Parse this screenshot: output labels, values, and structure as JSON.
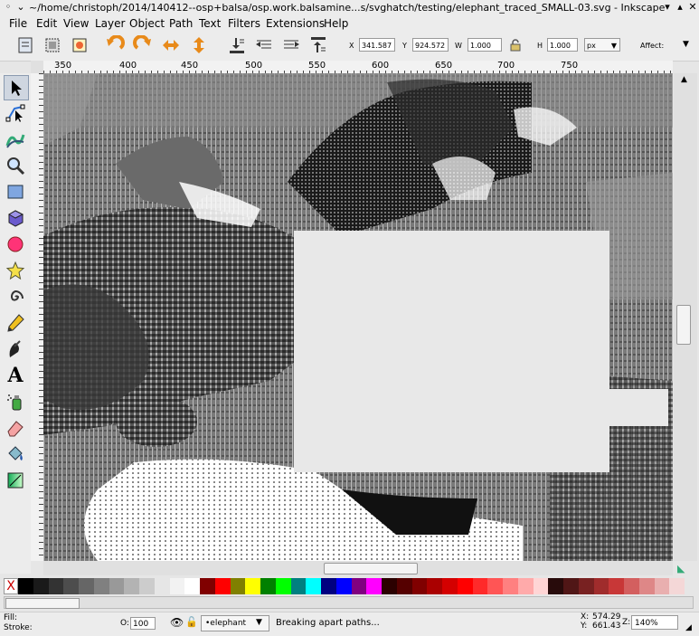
{
  "window": {
    "title": "~/home/christoph/2014/140412--osp+balsa/osp.work.balsamine...s/svghatch/testing/elephant_traced_SMALL-03.svg - Inkscape"
  },
  "menu": [
    "File",
    "Edit",
    "View",
    "Layer",
    "Object",
    "Path",
    "Text",
    "Filters",
    "Extensions",
    "Help"
  ],
  "toolbar": {
    "x_label": "X",
    "x_value": "341.587",
    "y_label": "Y",
    "y_value": "924.572",
    "w_label": "W",
    "w_value": "1.000",
    "h_label": "H",
    "h_value": "1.000",
    "unit": "px",
    "affect_label": "Affect:"
  },
  "ruler": {
    "ticks": [
      "350",
      "400",
      "450",
      "500",
      "550",
      "600",
      "650",
      "700",
      "750"
    ]
  },
  "tools": [
    "selector-icon",
    "node-icon",
    "tweak-icon",
    "zoom-icon",
    "rectangle-icon",
    "3dbox-icon",
    "ellipse-icon",
    "star-icon",
    "spiral-icon",
    "pencil-icon",
    "calligraphy-icon",
    "text-icon",
    "spray-icon",
    "eraser-icon",
    "paint-bucket-icon",
    "gradient-icon"
  ],
  "palette": {
    "none_label": "X",
    "colors": [
      "#000000",
      "#1a1a1a",
      "#333333",
      "#4d4d4d",
      "#666666",
      "#808080",
      "#999999",
      "#b3b3b3",
      "#cccccc",
      "#e6e6e6",
      "#f2f2f2",
      "#ffffff",
      "#800000",
      "#ff0000",
      "#808000",
      "#ffff00",
      "#008000",
      "#00ff00",
      "#008080",
      "#00ffff",
      "#000080",
      "#0000ff",
      "#800080",
      "#ff00ff",
      "#2b0000",
      "#550000",
      "#800000",
      "#aa0000",
      "#d40000",
      "#ff0000",
      "#ff2a2a",
      "#ff5555",
      "#ff8080",
      "#ffaaaa",
      "#ffd5d5",
      "#280b0b",
      "#501616",
      "#782121",
      "#a02c2c",
      "#c83737",
      "#d35f5f",
      "#de8787",
      "#e9afaf",
      "#f4d7d7"
    ]
  },
  "status": {
    "fill_label": "Fill:",
    "stroke_label": "Stroke:",
    "opacity_label": "O:",
    "opacity_value": "100",
    "layer_name": "•elephant",
    "message": "Breaking apart paths...",
    "cursor_x_label": "X:",
    "cursor_x": "574.29",
    "cursor_y_label": "Y:",
    "cursor_y": "661.43",
    "zoom_label": "Z:",
    "zoom_value": "140%"
  }
}
